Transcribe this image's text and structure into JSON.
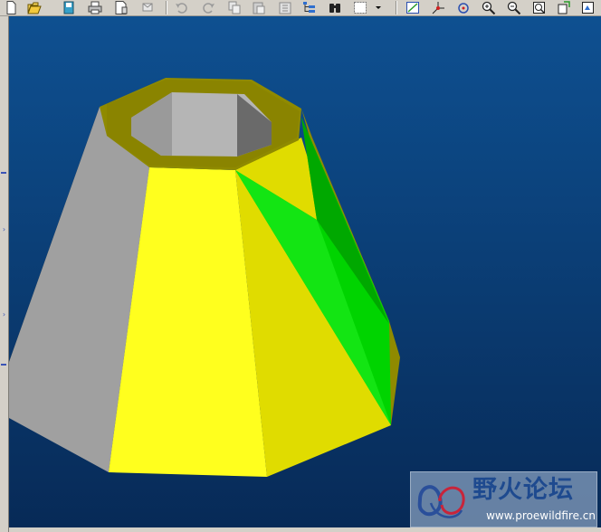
{
  "toolbar": {
    "buttons": [
      {
        "name": "new-file-icon"
      },
      {
        "name": "open-folder-icon"
      },
      {
        "name": "save-icon"
      },
      {
        "name": "print-icon"
      },
      {
        "name": "print-preview-icon"
      },
      {
        "name": "send-mail-icon"
      },
      {
        "name": "undo-icon"
      },
      {
        "name": "redo-icon"
      },
      {
        "name": "copy-icon"
      },
      {
        "name": "paste-icon"
      },
      {
        "name": "paste-special-icon"
      },
      {
        "name": "model-tree-icon"
      },
      {
        "name": "find-binoculars-icon"
      },
      {
        "name": "selection-box-icon"
      },
      {
        "name": "dropdown-arrow-icon"
      },
      {
        "name": "repaint-icon"
      },
      {
        "name": "spin-center-icon"
      },
      {
        "name": "orient-mode-icon"
      },
      {
        "name": "zoom-in-icon"
      },
      {
        "name": "zoom-out-icon"
      },
      {
        "name": "zoom-fit-icon"
      },
      {
        "name": "reorient-icon"
      },
      {
        "name": "saved-views-icon"
      }
    ]
  },
  "viewport": {
    "background_top": "#0e5091",
    "background_bottom": "#072a57",
    "model_colors": {
      "gray": "#a0a0a0",
      "black": "#1a1a1a",
      "yellow_bright": "#ffff1e",
      "yellow_mid": "#e0dc00",
      "olive": "#8f8a00",
      "green": "#00d400",
      "green_dark": "#00a800",
      "inner_gray": "#b5b5b5",
      "inner_dark": "#6a6a6a"
    }
  },
  "watermark": {
    "title": "野火论坛",
    "url": "www.proewildfire.cn"
  }
}
